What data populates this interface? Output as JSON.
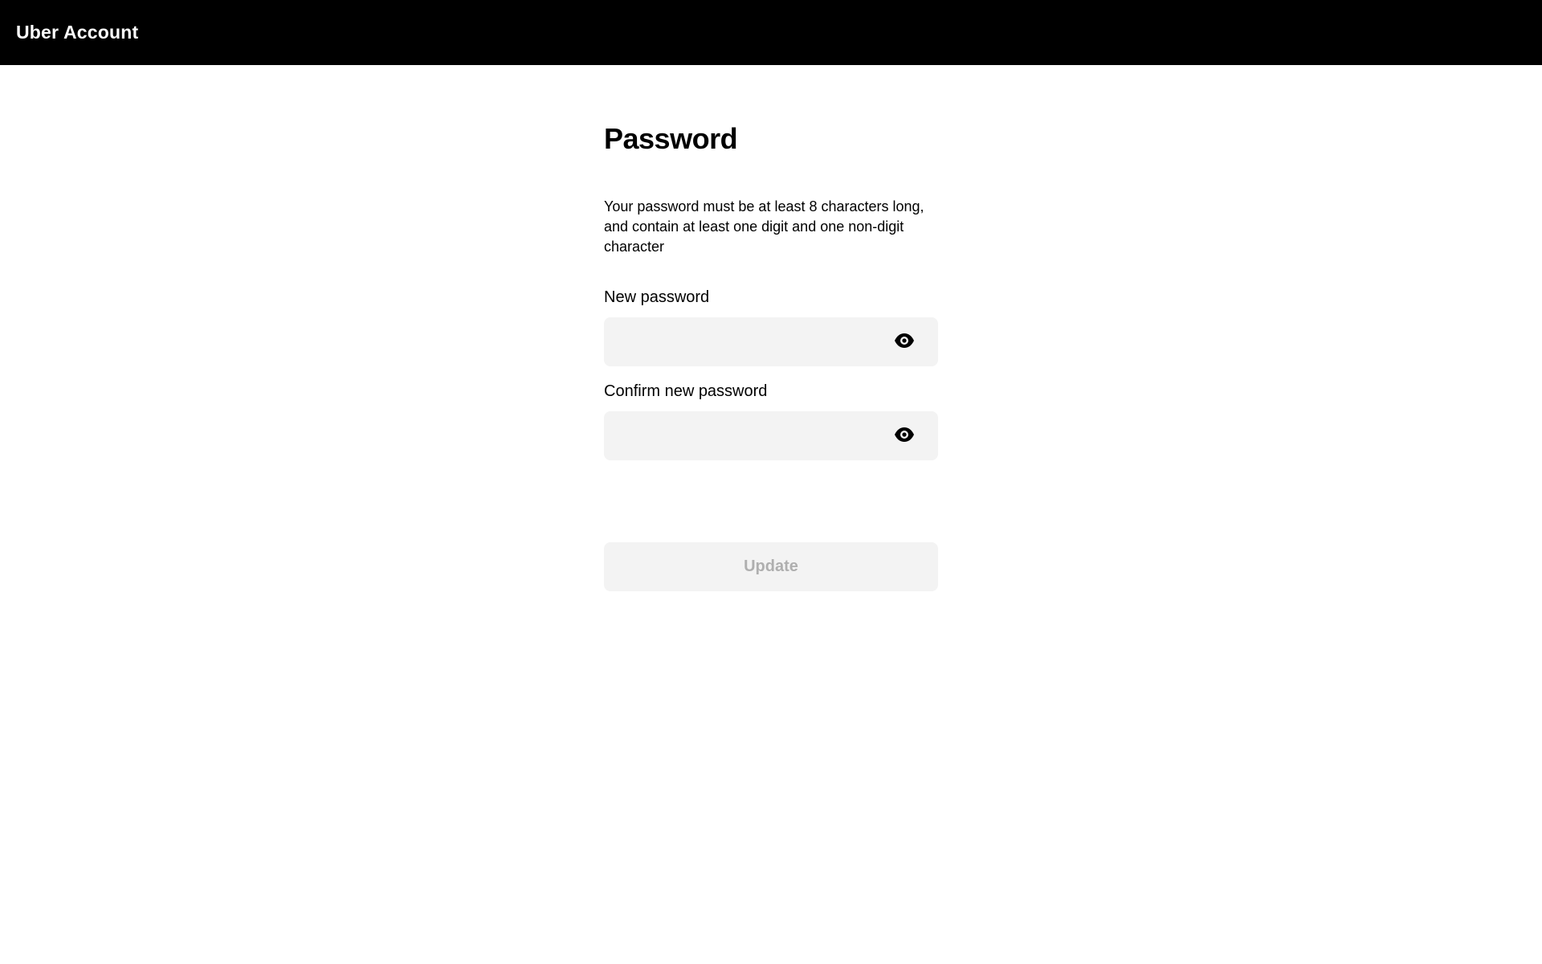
{
  "header": {
    "brand": "Uber Account"
  },
  "page": {
    "title": "Password",
    "help_text": "Your password must be at least 8 characters long, and contain at least one digit and one non-digit character"
  },
  "form": {
    "new_password": {
      "label": "New password",
      "value": "",
      "placeholder": "",
      "toggle_icon": "eye-icon"
    },
    "confirm_password": {
      "label": "Confirm new password",
      "value": "",
      "placeholder": "",
      "toggle_icon": "eye-icon"
    },
    "submit_label": "Update",
    "submit_disabled": true
  },
  "colors": {
    "header_bg": "#000000",
    "input_bg": "#f3f3f3",
    "disabled_text": "#afafaf"
  }
}
